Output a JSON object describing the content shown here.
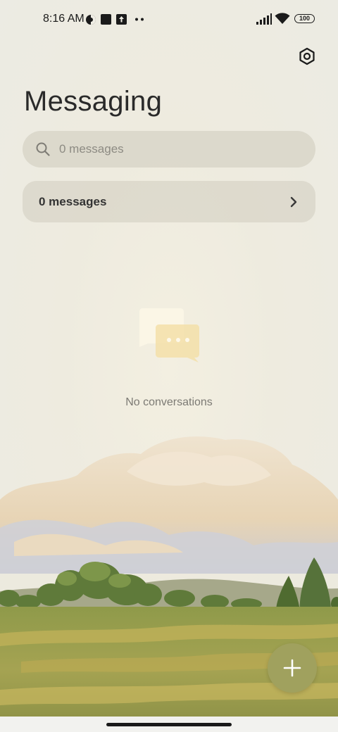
{
  "status_bar": {
    "time": "8:16 AM",
    "battery": "100",
    "icons": [
      "vpn-icon",
      "stop-square-icon",
      "upload-icon",
      "more-dots-icon",
      "signal-icon",
      "wifi-icon",
      "battery-icon"
    ]
  },
  "header": {
    "title": "Messaging",
    "settings_icon": "settings-hexagon-icon"
  },
  "search": {
    "placeholder": "0 messages",
    "value": ""
  },
  "messages_row": {
    "label": "0 messages"
  },
  "empty_state": {
    "text": "No conversations",
    "icon": "chat-bubbles-icon"
  },
  "fab": {
    "icon": "plus-icon"
  },
  "colors": {
    "background": "#efede4",
    "accent": "#a0a15e",
    "card": "#d3d0c2"
  }
}
